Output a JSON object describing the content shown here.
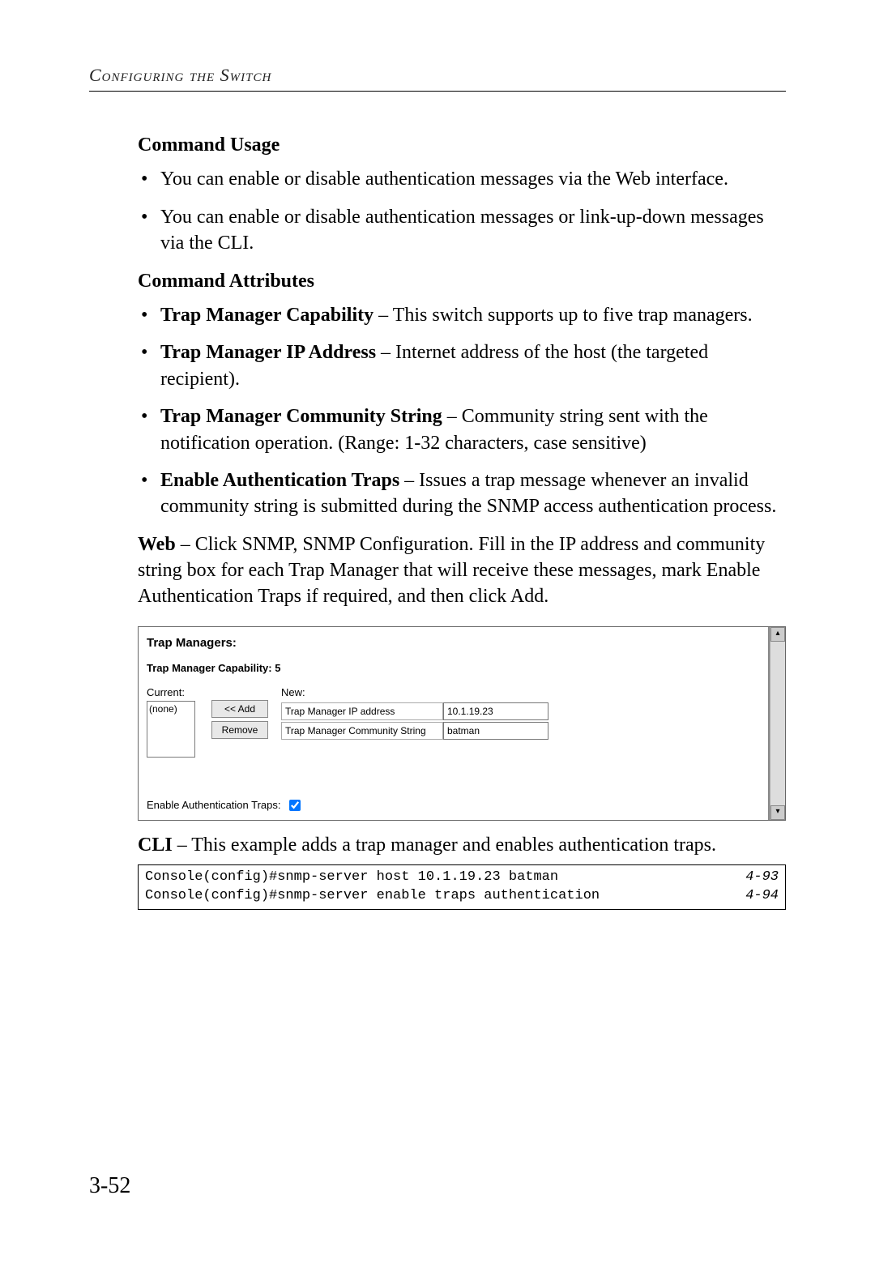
{
  "header": {
    "running_head": "Configuring the Switch"
  },
  "sections": {
    "command_usage": {
      "title": "Command Usage",
      "items": [
        "You can enable or disable authentication messages via the Web interface.",
        "You can enable or disable authentication messages or link-up-down messages via the CLI."
      ]
    },
    "command_attributes": {
      "title": "Command Attributes",
      "items": [
        {
          "term": "Trap Manager Capability",
          "desc": " – This switch supports up to five trap managers."
        },
        {
          "term": "Trap Manager IP Address",
          "desc": " – Internet address of the host (the targeted recipient)."
        },
        {
          "term": "Trap Manager Community String",
          "desc": " – Community string sent with the notification operation. (Range: 1-32 characters, case sensitive)"
        },
        {
          "term": "Enable Authentication Traps",
          "desc": " – Issues a trap message whenever an invalid community string is submitted during the SNMP access authentication process."
        }
      ]
    },
    "web_para": {
      "lead": "Web",
      "rest": " – Click SNMP, SNMP Configuration. Fill in the IP address and community string box for each Trap Manager that will receive these messages, mark Enable Authentication Traps if required, and then click Add."
    },
    "cli_para": {
      "lead": "CLI",
      "rest": " – This example adds a trap manager and enables authentication traps."
    }
  },
  "ui": {
    "heading": "Trap Managers:",
    "capability_label": "Trap Manager Capability: 5",
    "current_label": "Current:",
    "current_value": "(none)",
    "add_btn": "<< Add",
    "remove_btn": "Remove",
    "new_label": "New:",
    "ip_label": "Trap Manager IP address",
    "ip_value": "10.1.19.23",
    "comm_label": "Trap Manager Community String",
    "comm_value": "batman",
    "enable_label": "Enable Authentication Traps:",
    "scroll_up": "▴",
    "scroll_down": "▾"
  },
  "cli": {
    "lines": [
      {
        "cmd": "Console(config)#snmp-server host 10.1.19.23 batman",
        "ref": "4-93"
      },
      {
        "cmd": "Console(config)#snmp-server enable traps authentication",
        "ref": "4-94"
      }
    ]
  },
  "page_number": "3-52"
}
